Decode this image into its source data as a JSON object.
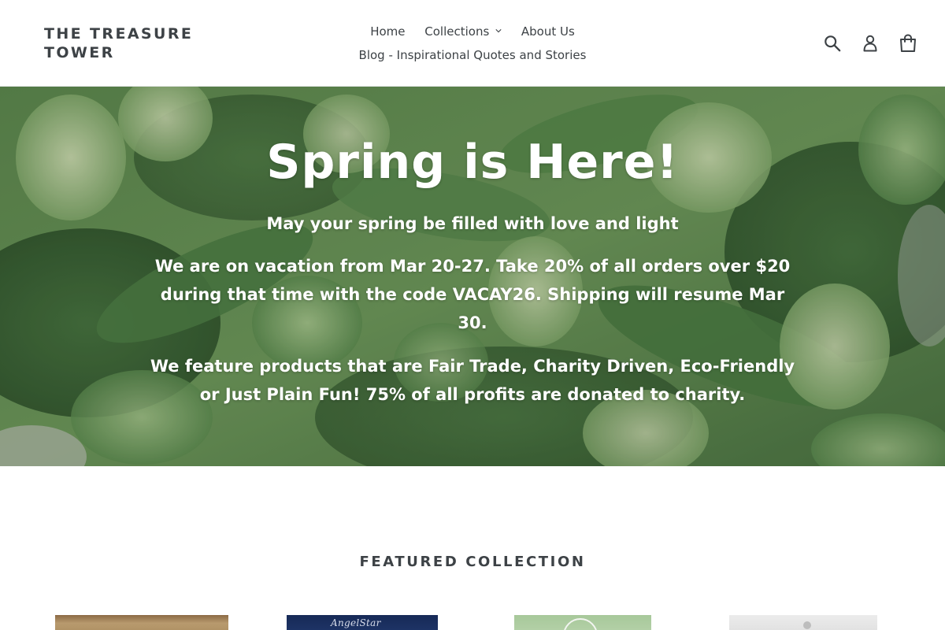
{
  "header": {
    "logo_line1": "THE TREASURE",
    "logo_line2": "TOWER",
    "nav": {
      "home": "Home",
      "collections": "Collections",
      "about": "About Us",
      "blog": "Blog - Inspirational Quotes and Stories"
    },
    "icons": {
      "search": "search-icon",
      "account": "user-icon",
      "cart": "cart-icon"
    }
  },
  "hero": {
    "title": "Spring is Here!",
    "subtitle": "May your spring be filled with love and light",
    "vacation_notice": "We are on vacation from Mar 20-27. Take 20% of all orders over $20 during that time with the code VACAY26. Shipping will resume Mar 30.",
    "mission": "We feature products that are Fair Trade, Charity Driven, Eco-Friendly or Just Plain Fun! 75% of all profits are donated to charity."
  },
  "featured": {
    "title": "FEATURED COLLECTION",
    "products": [
      {
        "thumb_label": ""
      },
      {
        "thumb_label": "AngelStar"
      },
      {
        "thumb_label": ""
      },
      {
        "thumb_label": ""
      }
    ]
  },
  "colors": {
    "text": "#3d4246",
    "background": "#ffffff",
    "hero_text": "#ffffff"
  }
}
